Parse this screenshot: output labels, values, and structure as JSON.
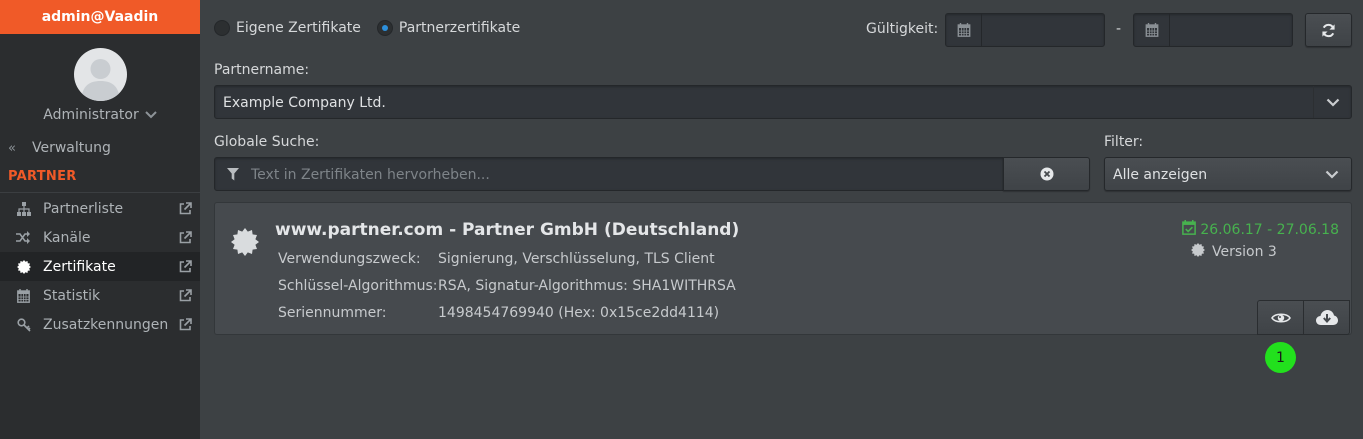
{
  "sidebar": {
    "header": "admin@Vaadin",
    "user": {
      "name": "Administrator"
    },
    "back_label": "Verwaltung",
    "section": "PARTNER",
    "items": [
      {
        "label": "Partnerliste",
        "icon": "sitemap-icon"
      },
      {
        "label": "Kanäle",
        "icon": "shuffle-icon"
      },
      {
        "label": "Zertifikate",
        "icon": "certificate-icon",
        "active": true
      },
      {
        "label": "Statistik",
        "icon": "calendar-icon"
      },
      {
        "label": "Zusatzkennungen",
        "icon": "key-icon"
      }
    ]
  },
  "filters": {
    "radio_own": "Eigene Zertifikate",
    "radio_partner": "Partnerzertifikate",
    "selected": "partner",
    "validity_label": "Gültigkeit:",
    "date_separator": "-",
    "date_from": "",
    "date_to": ""
  },
  "partner": {
    "label": "Partnername:",
    "value": "Example Company Ltd."
  },
  "search": {
    "label": "Globale Suche:",
    "placeholder": "Text in Zertifikaten hervorheben...",
    "value": ""
  },
  "filter": {
    "label": "Filter:",
    "value": "Alle anzeigen"
  },
  "certificate": {
    "title": "www.partner.com - Partner GmbH (Deutschland)",
    "fields": [
      {
        "key": "Verwendungszweck:",
        "value": "Signierung, Verschlüsselung, TLS Client"
      },
      {
        "key": "Schlüssel-Algorithmus:",
        "value": "RSA, Signatur-Algorithmus: SHA1WITHRSA"
      },
      {
        "key": "Seriennummer:",
        "value": "1498454769940 (Hex: 0x15ce2dd4114)"
      }
    ],
    "validity": "26.06.17 - 27.06.18",
    "version": "Version 3"
  },
  "marker": {
    "label": "1"
  },
  "colors": {
    "accent": "#f05a28",
    "valid": "#47b24e",
    "radio_selected": "#2c8fdb",
    "marker": "#22e01d"
  }
}
